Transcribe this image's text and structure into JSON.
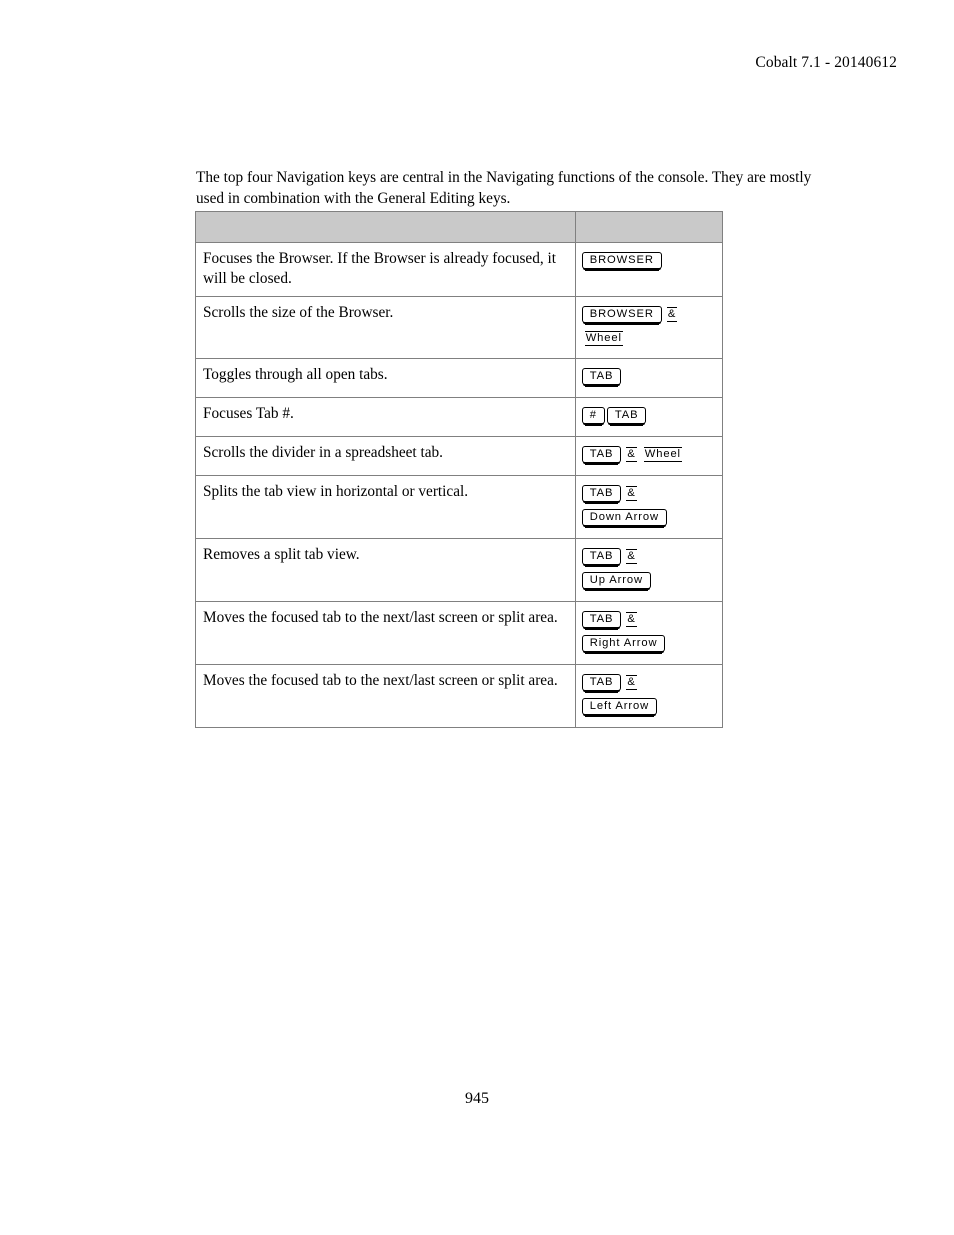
{
  "header": {
    "running_head": "Cobalt 7.1 - 20140612"
  },
  "intro": {
    "paragraph": "The top four Navigation keys are central in the Navigating functions of the console. They are mostly used in combination with the General Editing keys."
  },
  "table": {
    "columns": [
      {
        "header": ""
      },
      {
        "header": ""
      }
    ],
    "rows": [
      {
        "description": "Focuses the Browser. If the Browser is already focused, it will be closed.",
        "keys": [
          [
            {
              "type": "keycap",
              "label": "BROWSER"
            }
          ]
        ]
      },
      {
        "description": "Scrolls the size of the Browser.",
        "keys": [
          [
            {
              "type": "keycap",
              "label": "BROWSER"
            },
            {
              "type": "token",
              "label": "&"
            }
          ],
          [
            {
              "type": "token",
              "label": "Wheel"
            }
          ]
        ]
      },
      {
        "description": "Toggles through all open tabs.",
        "keys": [
          [
            {
              "type": "keycap",
              "label": "TAB"
            }
          ]
        ]
      },
      {
        "description": "Focuses Tab #.",
        "keys": [
          [
            {
              "type": "keycap",
              "label": "#"
            },
            {
              "type": "keycap",
              "label": "TAB"
            }
          ]
        ]
      },
      {
        "description": "Scrolls the divider in a spreadsheet tab.",
        "keys": [
          [
            {
              "type": "keycap",
              "label": "TAB"
            },
            {
              "type": "token",
              "label": "&"
            },
            {
              "type": "token",
              "label": "Wheel"
            }
          ]
        ]
      },
      {
        "description": "Splits the tab view in horizontal or vertical.",
        "keys": [
          [
            {
              "type": "keycap",
              "label": "TAB"
            },
            {
              "type": "token",
              "label": "&"
            }
          ],
          [
            {
              "type": "keycap",
              "label": "Down Arrow"
            }
          ]
        ]
      },
      {
        "description": "Removes a split tab view.",
        "keys": [
          [
            {
              "type": "keycap",
              "label": "TAB"
            },
            {
              "type": "token",
              "label": "&"
            }
          ],
          [
            {
              "type": "keycap",
              "label": "Up Arrow"
            }
          ]
        ]
      },
      {
        "description": "Moves the focused tab to the next/last screen or split area.",
        "keys": [
          [
            {
              "type": "keycap",
              "label": "TAB"
            },
            {
              "type": "token",
              "label": "&"
            }
          ],
          [
            {
              "type": "keycap",
              "label": "Right Arrow"
            }
          ]
        ]
      },
      {
        "description": "Moves the focused tab to the next/last screen or split area.",
        "keys": [
          [
            {
              "type": "keycap",
              "label": "TAB"
            },
            {
              "type": "token",
              "label": "&"
            }
          ],
          [
            {
              "type": "keycap",
              "label": "Left Arrow"
            }
          ]
        ]
      }
    ]
  },
  "footer": {
    "page_number": "945"
  },
  "style": {
    "header_row_fill": "#c9c9c9",
    "border_color": "#808080",
    "text_color": "#000000",
    "page_background": "#ffffff"
  }
}
